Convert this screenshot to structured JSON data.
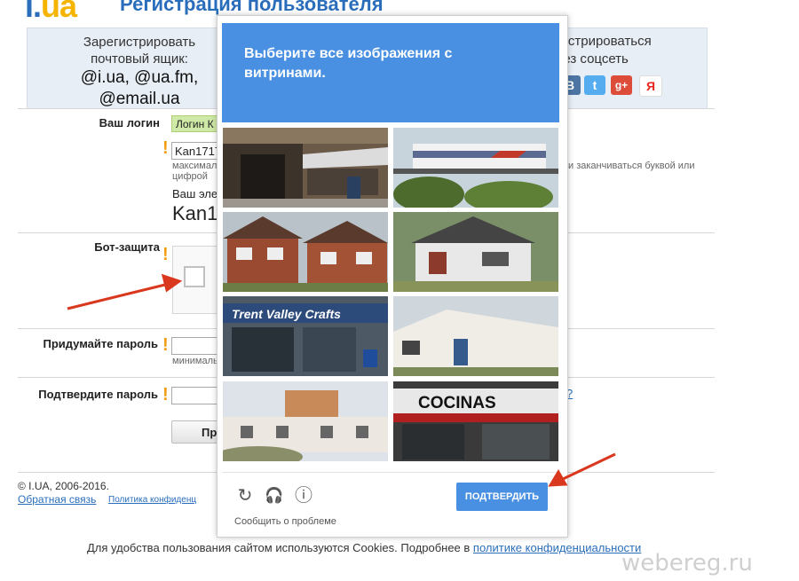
{
  "header": {
    "logo_dot": "i.",
    "logo_word": "ua",
    "title": "Регистрация пользователя"
  },
  "register_options": {
    "mail_line1": "Зарегистрировать",
    "mail_line2": "почтовый ящик:",
    "mail_domains_1": "@i.ua, @ua.fm,",
    "mail_domains_2": "@email.ua",
    "social_line1": "гистрироваться",
    "social_line2": "рез соцсеть",
    "social_icons": [
      "vk-icon",
      "twitter-icon",
      "google-plus-icon",
      "yandex-icon"
    ],
    "social_glyphs": [
      "B",
      "t",
      "g+",
      "Я"
    ]
  },
  "form": {
    "login_label": "Ваш логин",
    "login_hint": "Логин К",
    "login_value": "Kan1717",
    "login_note_1": "максимал",
    "login_note_2": "цифрой",
    "login_note_right": "и заканчиваться буквой или",
    "email_label": "Ваш эле",
    "email_big": "Kan1",
    "bot_label": "Бот-защита",
    "password_label": "Придумайте пароль",
    "password_note": "минималь",
    "confirm_label": "Подтвердите пароль",
    "confirm_tail": "?",
    "submit_label": "Пр"
  },
  "footer": {
    "copyright": "© I.UA, 2006-2016.",
    "feedback": "Обратная связь",
    "privacy": "Политика конфиденц",
    "cookies_text": "Для удобства пользования сайтом используются Cookies. Подробнее в ",
    "cookies_link": "политике конфиденциальности"
  },
  "watermark": "webereg.ru",
  "captcha": {
    "instruction_1": "Выберите все изображения с",
    "instruction_2": "витринами.",
    "tiles": [
      "storefront-with-awning",
      "bus-over-trees",
      "brick-houses",
      "white-house",
      "trent-valley-crafts-shop",
      "white-building",
      "village-houses",
      "cocinas-shop"
    ],
    "tile_text_trent": "Trent Valley Crafts",
    "tile_text_cocinas": "COCINAS",
    "reload_icon": "↻",
    "audio_icon": "🎧",
    "info_icon": "ⓘ",
    "report_problem": "Сообщить о проблеме",
    "verify_label": "ПОДТВЕРДИТЬ"
  },
  "colors": {
    "accent": "#4a90e2",
    "link": "#2a6ebb",
    "logo": "#f5b400",
    "warning": "#f39c12",
    "arrow": "#d9381e"
  }
}
